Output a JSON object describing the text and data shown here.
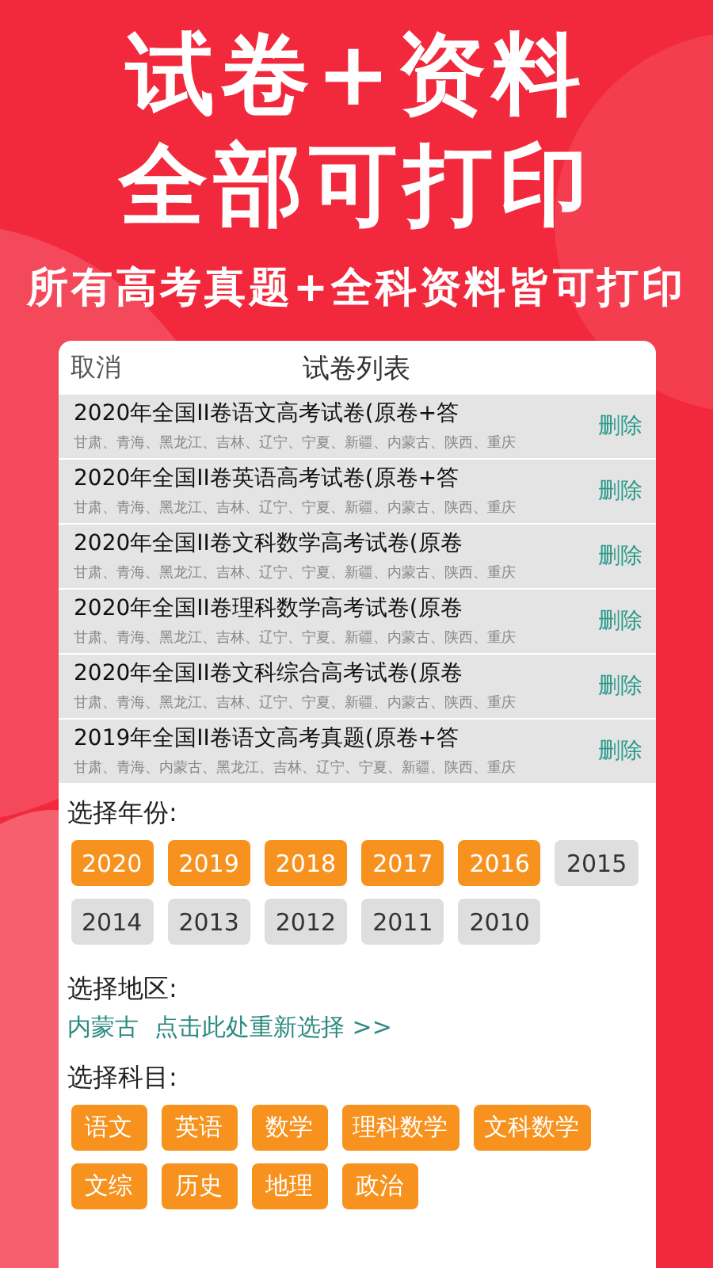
{
  "headline": [
    "试卷+资料",
    "全部可打印"
  ],
  "subtitle": "所有高考真题+全科资料皆可打印",
  "sheet": {
    "cancel": "取消",
    "title": "试卷列表"
  },
  "papers": [
    {
      "title": "2020年全国II卷语文高考试卷(原卷+答",
      "regions": "甘肃、青海、黑龙江、吉林、辽宁、宁夏、新疆、内蒙古、陕西、重庆",
      "action": "删除"
    },
    {
      "title": "2020年全国II卷英语高考试卷(原卷+答",
      "regions": "甘肃、青海、黑龙江、吉林、辽宁、宁夏、新疆、内蒙古、陕西、重庆",
      "action": "删除"
    },
    {
      "title": "2020年全国II卷文科数学高考试卷(原卷",
      "regions": "甘肃、青海、黑龙江、吉林、辽宁、宁夏、新疆、内蒙古、陕西、重庆",
      "action": "删除"
    },
    {
      "title": "2020年全国II卷理科数学高考试卷(原卷",
      "regions": "甘肃、青海、黑龙江、吉林、辽宁、宁夏、新疆、内蒙古、陕西、重庆",
      "action": "删除"
    },
    {
      "title": "2020年全国II卷文科综合高考试卷(原卷",
      "regions": "甘肃、青海、黑龙江、吉林、辽宁、宁夏、新疆、内蒙古、陕西、重庆",
      "action": "删除"
    },
    {
      "title": "2019年全国II卷语文高考真题(原卷+答",
      "regions": "甘肃、青海、内蒙古、黑龙江、吉林、辽宁、宁夏、新疆、陕西、重庆",
      "action": "删除"
    }
  ],
  "year_label": "选择年份:",
  "years": [
    {
      "label": "2020",
      "selected": true
    },
    {
      "label": "2019",
      "selected": true
    },
    {
      "label": "2018",
      "selected": true
    },
    {
      "label": "2017",
      "selected": true
    },
    {
      "label": "2016",
      "selected": true
    },
    {
      "label": "2015",
      "selected": false
    },
    {
      "label": "2014",
      "selected": false
    },
    {
      "label": "2013",
      "selected": false
    },
    {
      "label": "2012",
      "selected": false
    },
    {
      "label": "2011",
      "selected": false
    },
    {
      "label": "2010",
      "selected": false
    }
  ],
  "region_label": "选择地区:",
  "region": {
    "value": "内蒙古",
    "link": "点击此处重新选择 >>"
  },
  "subject_label": "选择科目:",
  "subjects": [
    {
      "label": "语文",
      "selected": true
    },
    {
      "label": "英语",
      "selected": true
    },
    {
      "label": "数学",
      "selected": true
    },
    {
      "label": "理科数学",
      "selected": true
    },
    {
      "label": "文科数学",
      "selected": true
    },
    {
      "label": "文综",
      "selected": true
    },
    {
      "label": "历史",
      "selected": true
    },
    {
      "label": "地理",
      "selected": true
    },
    {
      "label": "政治",
      "selected": true
    }
  ]
}
